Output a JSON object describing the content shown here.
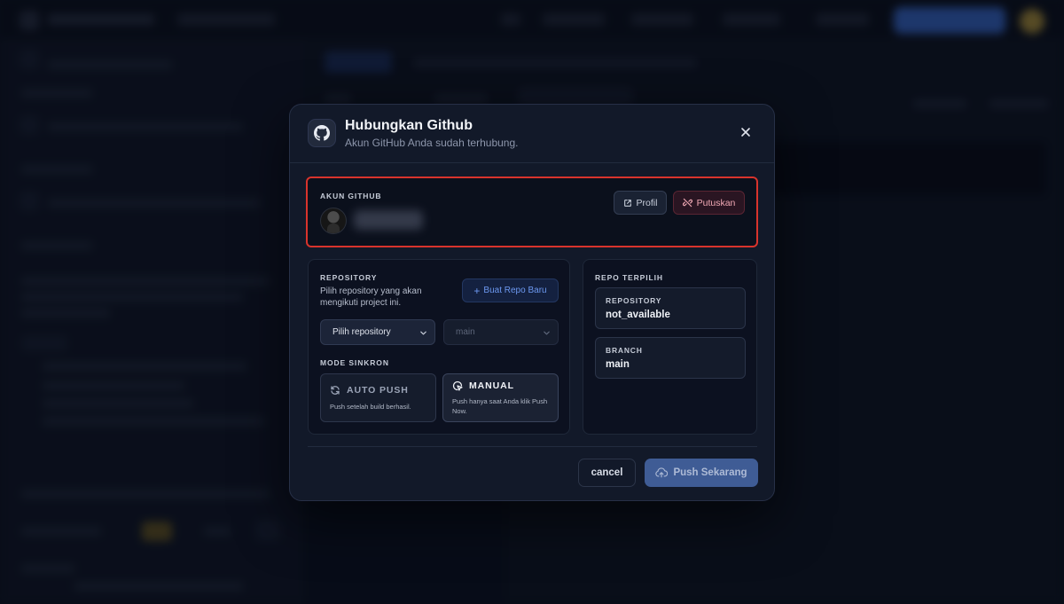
{
  "modal": {
    "title": "Hubungkan Github",
    "subtitle": "Akun GitHub Anda sudah terhubung.",
    "icon": "github-icon"
  },
  "account": {
    "section_label": "AKUN GITHUB",
    "profile_button": "Profil",
    "disconnect_button": "Putuskan"
  },
  "repository": {
    "section_label": "REPOSITORY",
    "description": "Pilih repository yang akan mengikuti project ini.",
    "new_repo_button": "Buat Repo Baru",
    "repo_select_value": "Pilih repository",
    "branch_select_value": "main"
  },
  "sync_mode": {
    "section_label": "MODE SINKRON",
    "options": [
      {
        "title": "AUTO PUSH",
        "description": "Push setelah build berhasil.",
        "selected": false
      },
      {
        "title": "MANUAL",
        "description": "Push hanya saat Anda klik Push Now.",
        "selected": true
      }
    ]
  },
  "selected_repo": {
    "section_label": "REPO TERPILIH",
    "repository_key": "REPOSITORY",
    "repository_value": "not_available",
    "branch_key": "BRANCH",
    "branch_value": "main"
  },
  "footer": {
    "cancel_button": "cancel",
    "push_button": "Push Sekarang"
  },
  "colors": {
    "highlight_border": "#d8332c",
    "accent": "#3f5c95",
    "danger_text": "#f0a8b4"
  }
}
